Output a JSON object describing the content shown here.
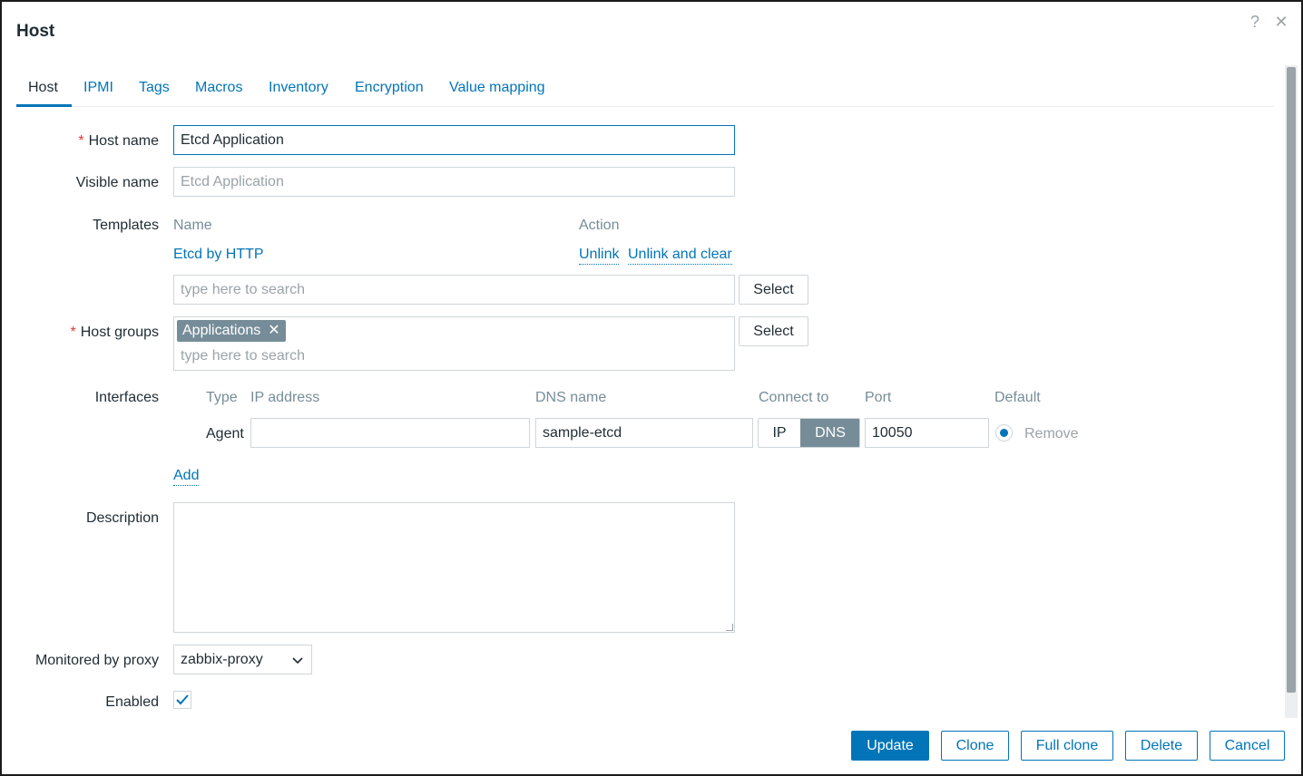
{
  "dialog": {
    "title": "Host",
    "help_label": "?",
    "close_label": "✕"
  },
  "tabs": [
    {
      "label": "Host"
    },
    {
      "label": "IPMI"
    },
    {
      "label": "Tags"
    },
    {
      "label": "Macros"
    },
    {
      "label": "Inventory"
    },
    {
      "label": "Encryption"
    },
    {
      "label": "Value mapping"
    }
  ],
  "form": {
    "required_marker": "*",
    "host_name": {
      "label": "Host name",
      "value": "Etcd Application"
    },
    "visible_name": {
      "label": "Visible name",
      "placeholder": "Etcd Application"
    },
    "templates": {
      "label": "Templates",
      "col_name": "Name",
      "col_action": "Action",
      "items": [
        {
          "name": "Etcd by HTTP",
          "unlink": "Unlink",
          "unlink_clear": "Unlink and clear"
        }
      ],
      "search_placeholder": "type here to search",
      "select_label": "Select"
    },
    "host_groups": {
      "label": "Host groups",
      "chips": [
        "Applications"
      ],
      "remove_icon": "✕",
      "search_placeholder": "type here to search",
      "select_label": "Select"
    },
    "interfaces": {
      "label": "Interfaces",
      "headers": {
        "type": "Type",
        "ip": "IP address",
        "dns": "DNS name",
        "connect": "Connect to",
        "port": "Port",
        "default": "Default"
      },
      "rows": [
        {
          "type": "Agent",
          "ip": "",
          "dns": "sample-etcd",
          "connect_ip": "IP",
          "connect_dns": "DNS",
          "port": "10050",
          "remove": "Remove"
        }
      ],
      "add_label": "Add"
    },
    "description": {
      "label": "Description",
      "value": ""
    },
    "proxy": {
      "label": "Monitored by proxy",
      "value": "zabbix-proxy"
    },
    "enabled": {
      "label": "Enabled",
      "checked": true
    }
  },
  "footer": {
    "update": "Update",
    "clone": "Clone",
    "full_clone": "Full clone",
    "delete": "Delete",
    "cancel": "Cancel"
  },
  "colors": {
    "accent": "#0275b8",
    "chip": "#768d99",
    "required": "#e33734"
  }
}
